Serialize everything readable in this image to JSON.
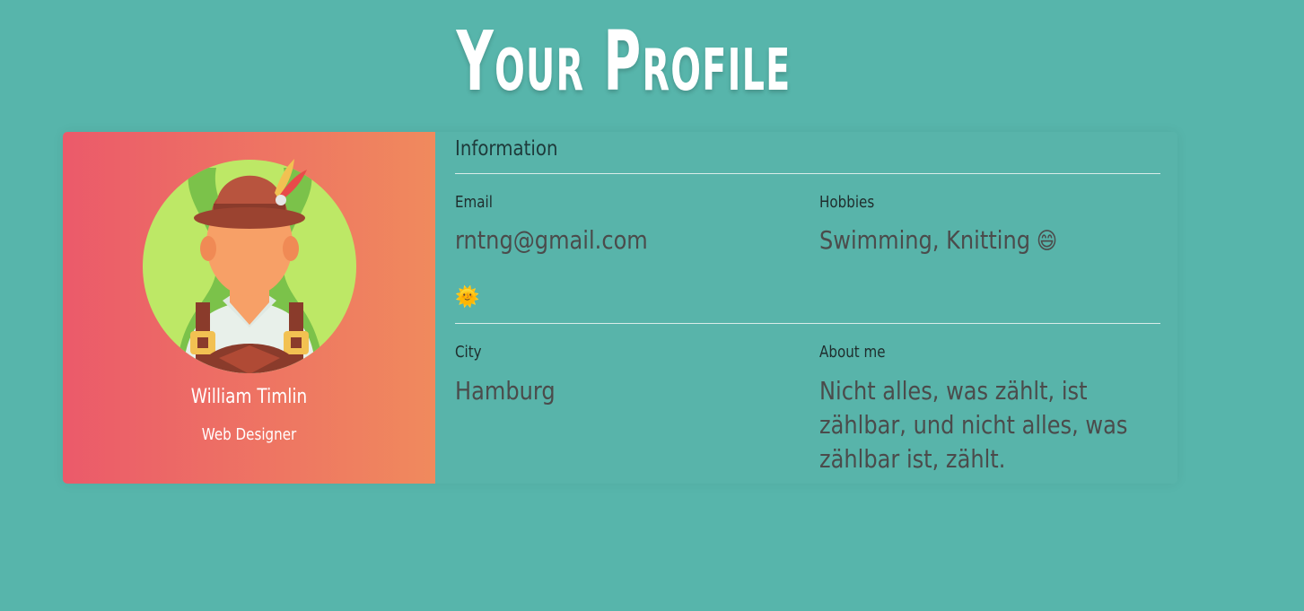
{
  "page": {
    "title": "Your Profile"
  },
  "profile": {
    "name": "William Timlin",
    "role": "Web Designer",
    "avatar_icon": "bavarian-man-avatar-icon"
  },
  "information": {
    "heading": "Information",
    "email_label": "Email",
    "email_value": "rntng@gmail.com",
    "hobbies_label": "Hobbies",
    "hobbies_value": "Swimming, Knitting",
    "hobbies_emoji": "😄",
    "section_emoji": "🌞",
    "city_label": "City",
    "city_value": "Hamburg",
    "about_label": "About me",
    "about_value": "Nicht alles, was zählt, ist zählbar, und nicht alles, was zählbar ist, zählt."
  },
  "colors": {
    "background": "#57b5ab",
    "gradient_start": "#eb5a6a",
    "gradient_end": "#f08a5d"
  }
}
